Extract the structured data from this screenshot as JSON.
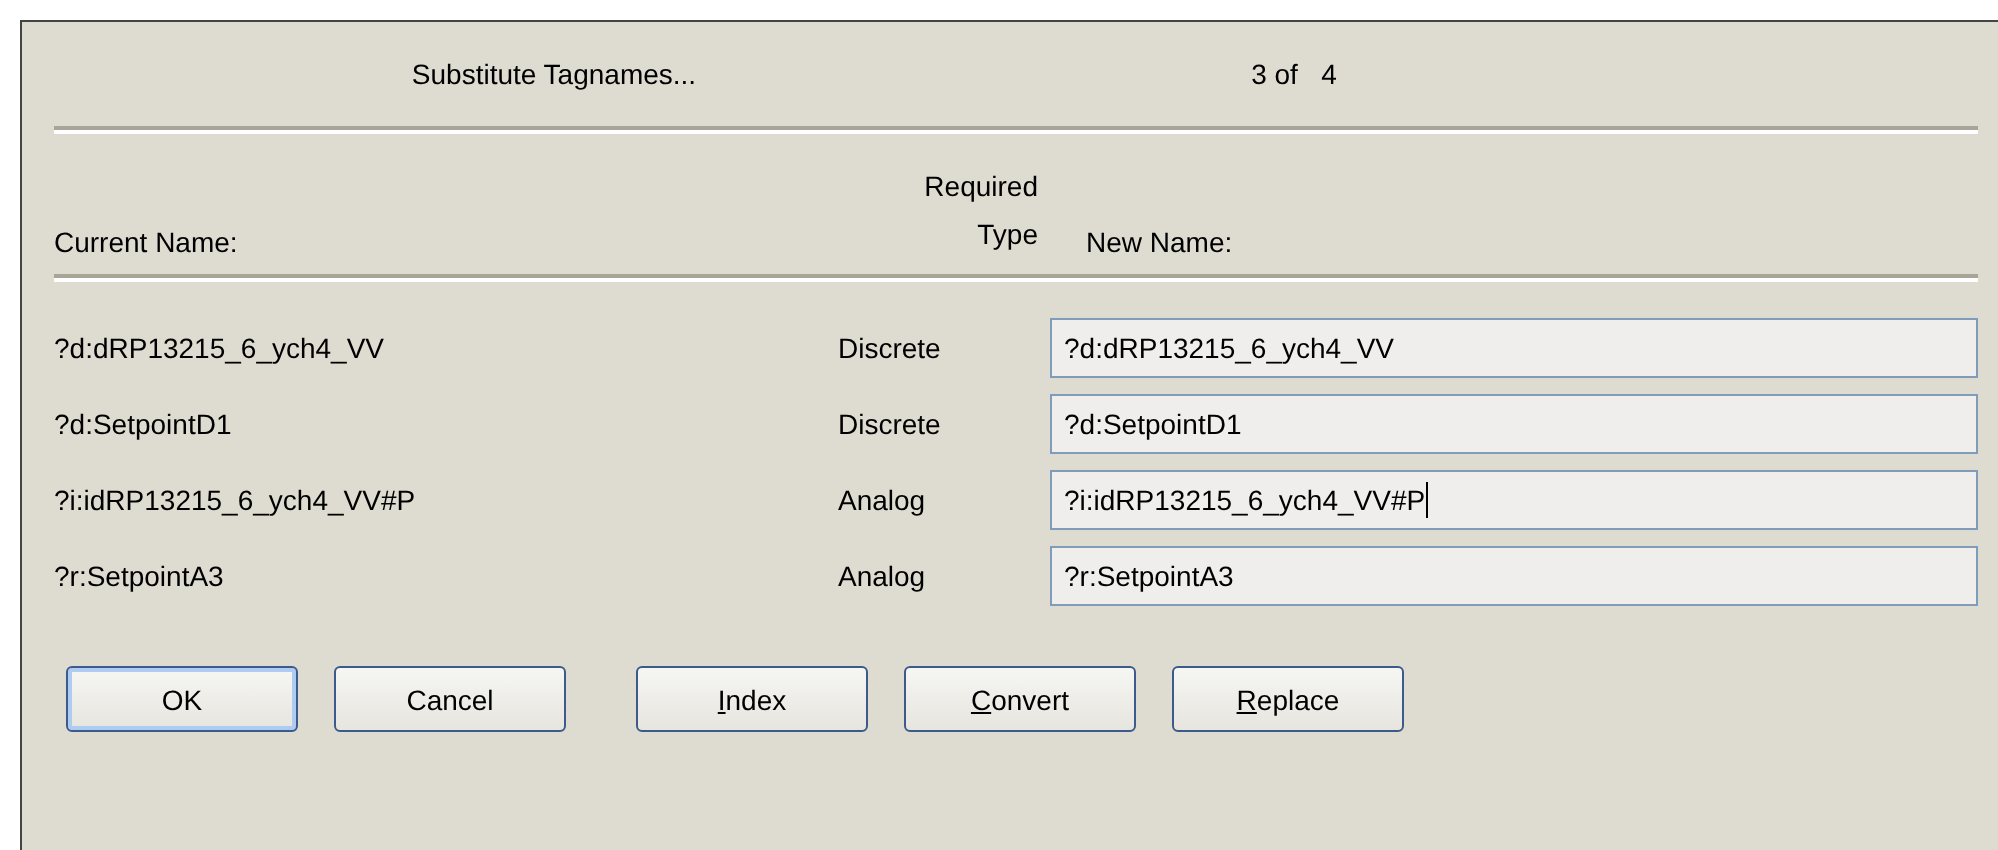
{
  "header": {
    "title": "Substitute Tagnames...",
    "counter": "3 of   4"
  },
  "columns": {
    "current": "Current Name:",
    "type_line1": "Required",
    "type_line2": "Type",
    "new": "New Name:"
  },
  "rows": [
    {
      "current": "?d:dRP13215_6_ych4_VV",
      "type": "Discrete",
      "new_name": "?d:dRP13215_6_ych4_VV",
      "focused": false
    },
    {
      "current": "?d:SetpointD1",
      "type": "Discrete",
      "new_name": "?d:SetpointD1",
      "focused": false
    },
    {
      "current": "?i:idRP13215_6_ych4_VV#P",
      "type": "Analog",
      "new_name": "?i:idRP13215_6_ych4_VV#P",
      "focused": true
    },
    {
      "current": "?r:SetpointA3",
      "type": "Analog",
      "new_name": "?r:SetpointA3",
      "focused": false
    }
  ],
  "buttons": [
    {
      "rest": "OK",
      "default": true
    },
    {
      "rest": "Cancel",
      "default": false
    },
    {
      "accel": "I",
      "rest": "ndex",
      "default": false
    },
    {
      "accel": "C",
      "rest": "onvert",
      "default": false
    },
    {
      "accel": "R",
      "rest": "eplace",
      "default": false
    }
  ]
}
